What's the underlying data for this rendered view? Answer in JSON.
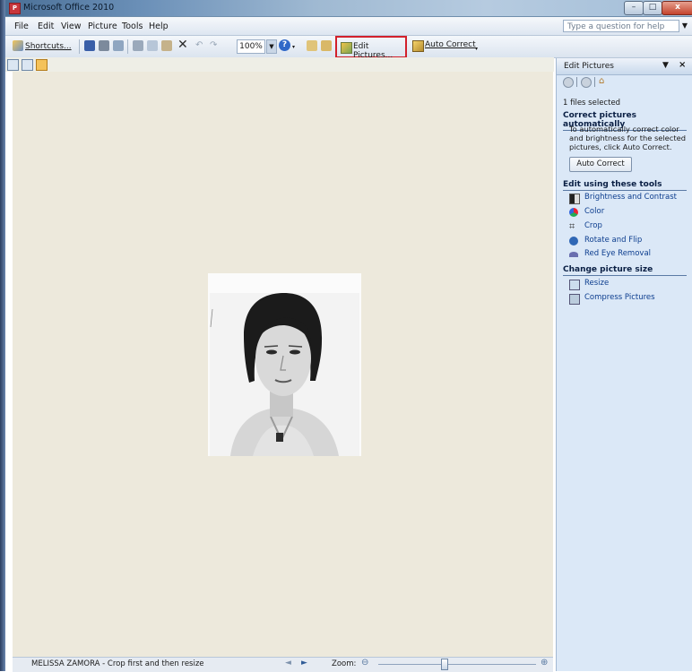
{
  "window": {
    "title": "Microsoft Office 2010",
    "app_icon_glyph": "P"
  },
  "window_controls": {
    "minimize": "–",
    "maximize": "□",
    "close": "x"
  },
  "menu": {
    "items": [
      "File",
      "Edit",
      "View",
      "Picture",
      "Tools",
      "Help"
    ],
    "help_placeholder": "Type a question for help"
  },
  "toolbar": {
    "shortcuts_label": "Shortcuts...",
    "zoom_value": "100%",
    "edit_pictures_label": "Edit Pictures...",
    "auto_correct_label": "Auto Correct"
  },
  "statusbar": {
    "file_label": "MELISSA ZAMORA - Crop first and then resize",
    "zoom_label": "Zoom:",
    "zoom_slider_fraction": 0.42
  },
  "taskpane": {
    "title": "Edit Pictures",
    "files_selected": "1 files selected",
    "section_correct": "Correct pictures automatically",
    "correct_description": "To automatically correct color and brightness for the selected pictures, click Auto Correct.",
    "auto_correct_button": "Auto Correct",
    "section_edit": "Edit using these tools",
    "tools": [
      "Brightness and Contrast",
      "Color",
      "Crop",
      "Rotate and Flip",
      "Red Eye Removal"
    ],
    "section_size": "Change picture size",
    "size_tools": [
      "Resize",
      "Compress Pictures"
    ]
  },
  "colors": {
    "canvas": "#ede9dc",
    "highlight_border": "#d2202b",
    "link": "#0c3d8e",
    "pane_background": "#dbe8f7"
  }
}
